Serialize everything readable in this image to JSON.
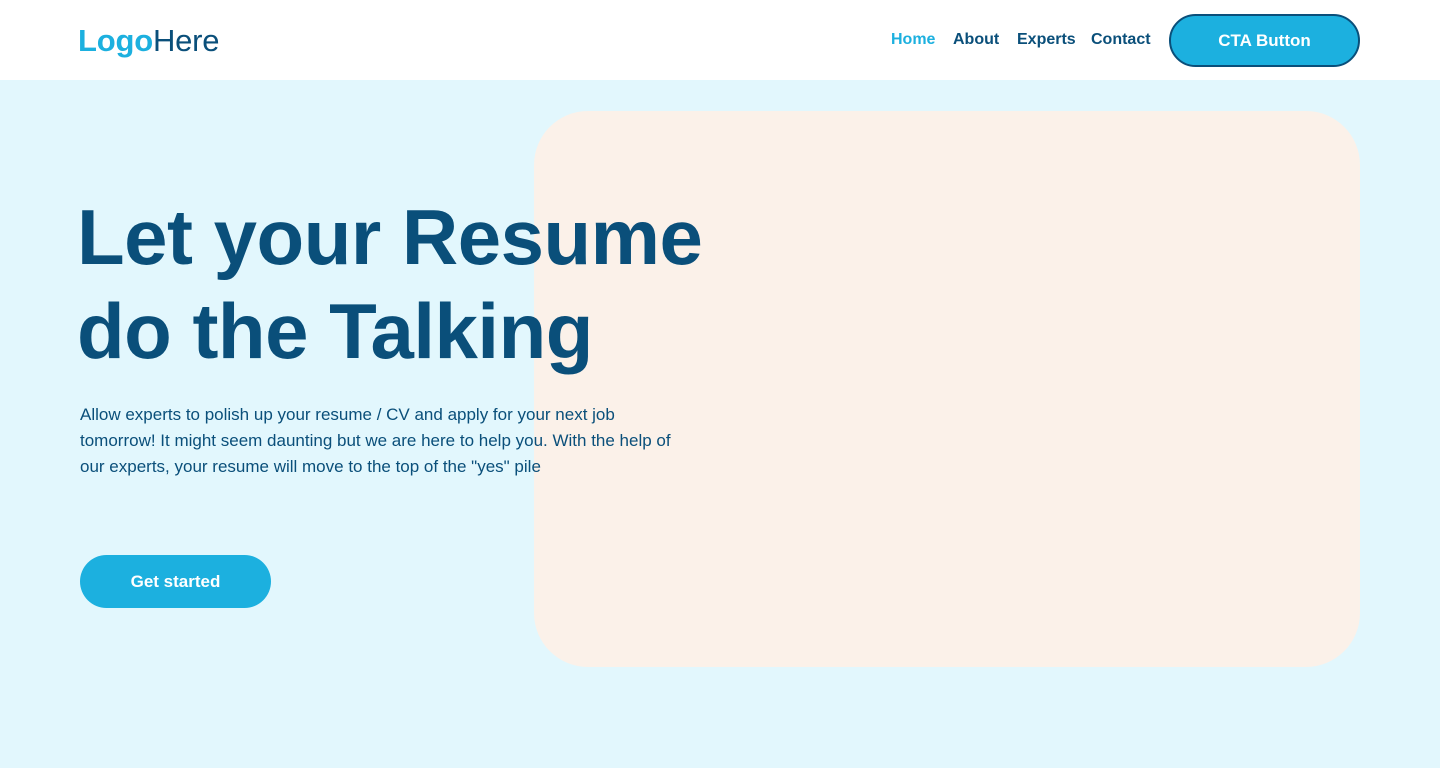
{
  "header": {
    "logo": {
      "part1": "Logo",
      "part2": "Here"
    },
    "nav": [
      {
        "label": "Home",
        "active": true
      },
      {
        "label": "About",
        "active": false
      },
      {
        "label": "Experts",
        "active": false
      },
      {
        "label": "Contact",
        "active": false
      }
    ],
    "cta_label": "CTA Button"
  },
  "hero": {
    "headline_lines": [
      "Let your Resume",
      "do the Talking"
    ],
    "description": "Allow experts to polish up your resume / CV and apply for your next job tomorrow! It might seem daunting but we are here to help you. With the help of our experts, your resume will move to the top of the \"yes\" pile",
    "button_label": "Get started"
  },
  "colors": {
    "page_background": "#e2f7fd",
    "header_background": "#ffffff",
    "brand_primary": "#1cb0df",
    "brand_dark": "#0a4f7a",
    "media_card": "#fbf1e9"
  }
}
